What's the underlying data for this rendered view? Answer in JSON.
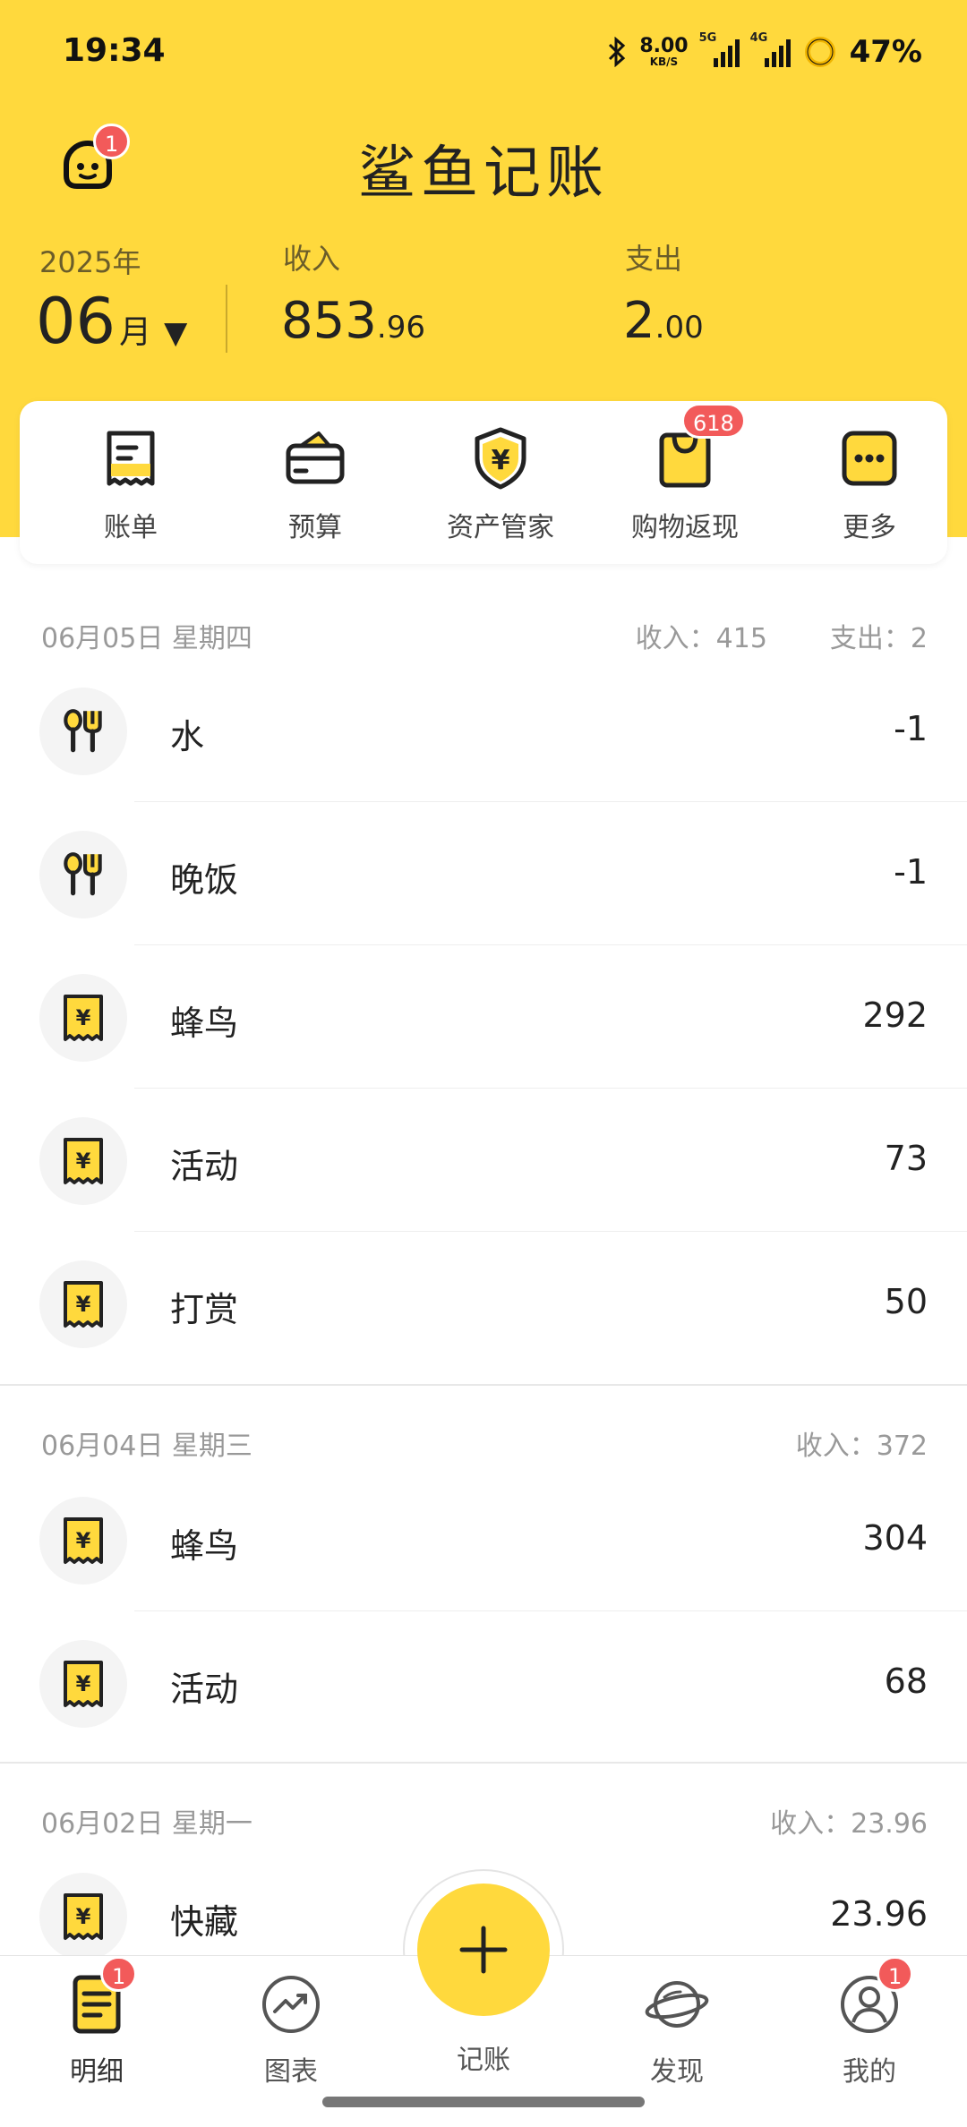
{
  "status_bar": {
    "time": "19:34",
    "net_speed": "8.00",
    "net_unit": "KB/S",
    "sig1": "5G",
    "sig2": "4G",
    "battery": "47%"
  },
  "header": {
    "title": "鲨鱼记账",
    "avatar_badge": "1",
    "year": "2025年",
    "month": "06",
    "month_unit": "月",
    "income_label": "收入",
    "income_int": "853",
    "income_dec": ".96",
    "expense_label": "支出",
    "expense_int": "2",
    "expense_dec": ".00"
  },
  "quick_menu": [
    {
      "label": "账单",
      "icon": "bill-icon"
    },
    {
      "label": "预算",
      "icon": "budget-wallet-icon"
    },
    {
      "label": "资产管家",
      "icon": "asset-shield-icon"
    },
    {
      "label": "购物返现",
      "icon": "shopping-bag-icon",
      "badge": "618"
    },
    {
      "label": "更多",
      "icon": "more-dots-icon"
    }
  ],
  "days": [
    {
      "date": "06月05日 星期四",
      "income": "收入：415",
      "expense": "支出：2",
      "entries": [
        {
          "name": "水",
          "amount": "-1",
          "icon": "dining-utensils-icon"
        },
        {
          "name": "晚饭",
          "amount": "-1",
          "icon": "dining-utensils-icon"
        },
        {
          "name": "蜂鸟",
          "amount": "292",
          "icon": "receipt-yen-icon"
        },
        {
          "name": "活动",
          "amount": "73",
          "icon": "receipt-yen-icon"
        },
        {
          "name": "打赏",
          "amount": "50",
          "icon": "receipt-yen-icon"
        }
      ]
    },
    {
      "date": "06月04日 星期三",
      "income": "收入：372",
      "entries": [
        {
          "name": "蜂鸟",
          "amount": "304",
          "icon": "receipt-yen-icon"
        },
        {
          "name": "活动",
          "amount": "68",
          "icon": "receipt-yen-icon"
        }
      ]
    },
    {
      "date": "06月02日 星期一",
      "income": "收入：23.96",
      "entries": [
        {
          "name": "快藏",
          "amount": "23.96",
          "icon": "receipt-yen-icon"
        }
      ]
    }
  ],
  "bottom_nav": {
    "items": [
      {
        "label": "明细",
        "icon": "detail-list-icon",
        "badge": "1"
      },
      {
        "label": "图表",
        "icon": "chart-trend-icon"
      },
      {
        "label": "记账",
        "icon": "plus-icon"
      },
      {
        "label": "发现",
        "icon": "planet-discover-icon"
      },
      {
        "label": "我的",
        "icon": "profile-icon",
        "badge": "1"
      }
    ]
  },
  "colors": {
    "brand_yellow": "#FFD93D",
    "badge_red": "#F25A5A"
  }
}
